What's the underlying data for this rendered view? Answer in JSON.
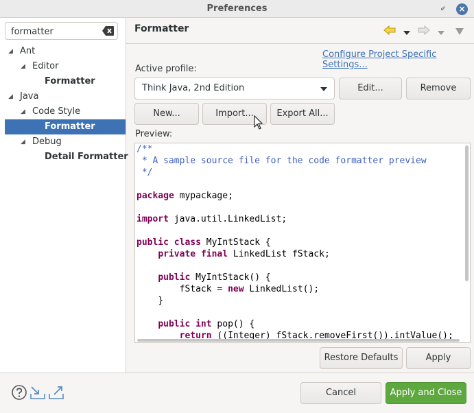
{
  "window": {
    "title": "Preferences"
  },
  "filter": {
    "value": "formatter",
    "clear_icon": "clear-text-icon"
  },
  "tree": {
    "items": [
      {
        "label": "Ant",
        "level": 0,
        "expanded": true,
        "bold": false
      },
      {
        "label": "Editor",
        "level": 1,
        "expanded": true,
        "bold": false
      },
      {
        "label": "Formatter",
        "level": 2,
        "bold": true
      },
      {
        "label": "Java",
        "level": 0,
        "expanded": true,
        "bold": false
      },
      {
        "label": "Code Style",
        "level": 1,
        "expanded": true,
        "bold": false
      },
      {
        "label": "Formatter",
        "level": 2,
        "bold": true,
        "selected": true
      },
      {
        "label": "Debug",
        "level": 1,
        "expanded": true,
        "bold": false
      },
      {
        "label": "Detail Formatter",
        "level": 2,
        "bold": true
      }
    ]
  },
  "page": {
    "title": "Formatter",
    "configure_link": "Configure Project Specific Settings...",
    "active_profile_label": "Active profile:",
    "profile_value": "Think Java, 2nd Edition",
    "preview_label": "Preview:"
  },
  "buttons": {
    "edit": "Edit...",
    "remove": "Remove",
    "new": "New...",
    "import": "Import...",
    "export_all": "Export All...",
    "restore_defaults": "Restore Defaults",
    "apply": "Apply",
    "cancel": "Cancel",
    "apply_and_close": "Apply and Close"
  },
  "colors": {
    "selection": "#3d72b4",
    "link": "#3d72b4",
    "primary_button": "#5ea93f",
    "keyword": "#7f0055",
    "comment": "#3f5fbf"
  },
  "code": {
    "comment1": "/**",
    "comment2": " * A sample source file for the code formatter preview",
    "comment3": " */",
    "kw_package": "package",
    "pkg_name": " mypackage;",
    "kw_import": "import",
    "import_name": " java.util.LinkedList;",
    "kw_public": "public",
    "kw_class": "class",
    "class_decl": " MyIntStack {",
    "kw_private": "private",
    "kw_final": "final",
    "field_decl": " LinkedList fStack;",
    "ctor_decl": " MyIntStack() {",
    "assign_pre": "fStack = ",
    "kw_new": "new",
    "assign_post": " LinkedList();",
    "close_brace": "}",
    "kw_int": "int",
    "pop_decl": " pop() {",
    "kw_return": "return",
    "return_expr": " ((Integer) fStack.removeFirst()).intValue();"
  }
}
